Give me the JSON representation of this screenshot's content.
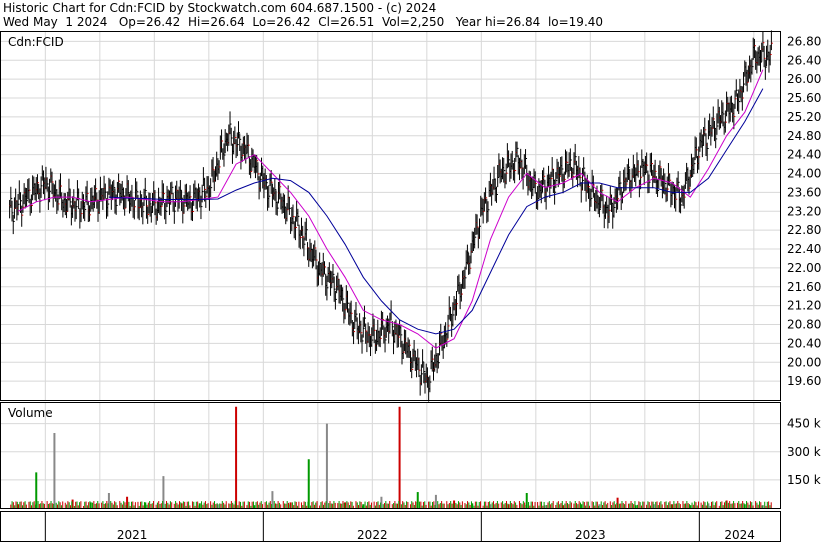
{
  "header": {
    "line1": "Historic Chart for Cdn:FCID by Stockwatch.com 604.687.1500 - (c) 2024",
    "line2": "Wed May  1 2024   Op=26.42  Hi=26.64  Lo=26.42  Cl=26.51  Vol=2,250   Year hi=26.84  lo=19.40"
  },
  "chart_data": [
    {
      "type": "line",
      "title": "Cdn:FCID",
      "ylim": [
        19.2,
        27.0
      ],
      "y_ticks": [
        "26.80",
        "26.40",
        "26.00",
        "25.60",
        "25.20",
        "24.80",
        "24.40",
        "24.00",
        "23.60",
        "23.20",
        "22.80",
        "22.40",
        "22.00",
        "21.60",
        "21.20",
        "20.80",
        "20.40",
        "20.00",
        "19.60"
      ],
      "x_ticks": [
        "2021",
        "2022",
        "2023",
        "2024"
      ],
      "series": [
        {
          "style": "price-bars",
          "color": "#000000",
          "x": [
            "2020-11",
            "2020-12",
            "2021-01",
            "2021-02",
            "2021-03",
            "2021-04",
            "2021-05",
            "2021-06",
            "2021-07",
            "2021-08",
            "2021-09",
            "2021-10",
            "2021-11",
            "2021-12",
            "2022-01",
            "2022-02",
            "2022-03",
            "2022-04",
            "2022-05",
            "2022-06",
            "2022-07",
            "2022-08",
            "2022-09",
            "2022-10",
            "2022-11",
            "2022-12",
            "2023-01",
            "2023-02",
            "2023-03",
            "2023-04",
            "2023-05",
            "2023-06",
            "2023-07",
            "2023-08",
            "2023-09",
            "2023-10",
            "2023-11",
            "2023-12",
            "2024-01",
            "2024-02",
            "2024-03",
            "2024-04"
          ],
          "values": [
            23.2,
            23.5,
            23.8,
            23.4,
            23.3,
            23.5,
            23.6,
            23.4,
            23.3,
            23.5,
            23.4,
            23.7,
            24.8,
            24.5,
            23.8,
            23.4,
            22.8,
            22.0,
            21.6,
            20.8,
            20.5,
            20.8,
            20.2,
            19.6,
            20.6,
            21.8,
            23.2,
            24.0,
            24.3,
            23.6,
            23.9,
            24.2,
            23.6,
            23.2,
            23.9,
            24.1,
            23.8,
            23.5,
            24.6,
            25.1,
            25.5,
            26.5
          ]
        },
        {
          "style": "moving-average",
          "color": "#cc00cc",
          "x": [
            "2020-11",
            "2020-12",
            "2021-01",
            "2021-02",
            "2021-03",
            "2021-04",
            "2021-05",
            "2021-06",
            "2021-07",
            "2021-08",
            "2021-09",
            "2021-10",
            "2021-11",
            "2021-12",
            "2022-01",
            "2022-02",
            "2022-03",
            "2022-04",
            "2022-05",
            "2022-06",
            "2022-07",
            "2022-08",
            "2022-09",
            "2022-10",
            "2022-11",
            "2022-12",
            "2023-01",
            "2023-02",
            "2023-03",
            "2023-04",
            "2023-05",
            "2023-06",
            "2023-07",
            "2023-08",
            "2023-09",
            "2023-10",
            "2023-11",
            "2023-12",
            "2024-01",
            "2024-02",
            "2024-03",
            "2024-04"
          ],
          "values": [
            23.2,
            23.4,
            23.5,
            23.5,
            23.4,
            23.45,
            23.5,
            23.45,
            23.4,
            23.4,
            23.45,
            23.5,
            24.2,
            24.4,
            24.0,
            23.6,
            23.1,
            22.4,
            21.8,
            21.1,
            20.9,
            20.8,
            20.6,
            20.3,
            20.5,
            21.3,
            22.6,
            23.5,
            24.0,
            23.7,
            23.8,
            24.0,
            23.6,
            23.4,
            23.7,
            23.9,
            23.8,
            23.5,
            24.1,
            24.8,
            25.3,
            26.2
          ]
        },
        {
          "style": "moving-average",
          "color": "#000099",
          "x": [
            "2020-11",
            "2020-12",
            "2021-01",
            "2021-02",
            "2021-03",
            "2021-04",
            "2021-05",
            "2021-06",
            "2021-07",
            "2021-08",
            "2021-09",
            "2021-10",
            "2021-11",
            "2021-12",
            "2022-01",
            "2022-02",
            "2022-03",
            "2022-04",
            "2022-05",
            "2022-06",
            "2022-07",
            "2022-08",
            "2022-09",
            "2022-10",
            "2022-11",
            "2022-12",
            "2023-01",
            "2023-02",
            "2023-03",
            "2023-04",
            "2023-05",
            "2023-06",
            "2023-07",
            "2023-08",
            "2023-09",
            "2023-10",
            "2023-11",
            "2023-12",
            "2024-01",
            "2024-02",
            "2024-03",
            "2024-04"
          ],
          "values": [
            null,
            null,
            null,
            null,
            null,
            23.5,
            23.48,
            23.47,
            23.45,
            23.45,
            23.45,
            23.46,
            23.65,
            23.8,
            23.9,
            23.85,
            23.6,
            23.1,
            22.5,
            21.8,
            21.3,
            20.9,
            20.7,
            20.6,
            20.7,
            21.1,
            21.9,
            22.7,
            23.3,
            23.5,
            23.6,
            23.8,
            23.8,
            23.7,
            23.7,
            23.7,
            23.6,
            23.6,
            23.9,
            24.5,
            25.1,
            25.8
          ]
        }
      ]
    },
    {
      "type": "bar",
      "title": "Volume",
      "y_ticks": [
        "450 k",
        "300 k",
        "150 k"
      ],
      "ylim": [
        0,
        560000
      ],
      "x": [
        "2020-11",
        "2020-12",
        "2021-01",
        "2021-02",
        "2021-03",
        "2021-04",
        "2021-05",
        "2021-06",
        "2021-07",
        "2021-08",
        "2021-09",
        "2021-10",
        "2021-11",
        "2021-12",
        "2022-01",
        "2022-02",
        "2022-03",
        "2022-04",
        "2022-05",
        "2022-06",
        "2022-07",
        "2022-08",
        "2022-09",
        "2022-10",
        "2022-11",
        "2022-12",
        "2023-01",
        "2023-02",
        "2023-03",
        "2023-04",
        "2023-05",
        "2023-06",
        "2023-07",
        "2023-08",
        "2023-09",
        "2023-10",
        "2023-11",
        "2023-12",
        "2024-01",
        "2024-02",
        "2024-03",
        "2024-04"
      ],
      "values": [
        20000,
        190000,
        400000,
        45000,
        30000,
        80000,
        60000,
        30000,
        170000,
        25000,
        25000,
        20000,
        540000,
        15000,
        90000,
        30000,
        260000,
        450000,
        30000,
        20000,
        60000,
        540000,
        85000,
        70000,
        40000,
        25000,
        20000,
        20000,
        80000,
        15000,
        15000,
        20000,
        20000,
        55000,
        15000,
        20000,
        20000,
        15000,
        25000,
        40000,
        20000,
        15000
      ]
    }
  ]
}
